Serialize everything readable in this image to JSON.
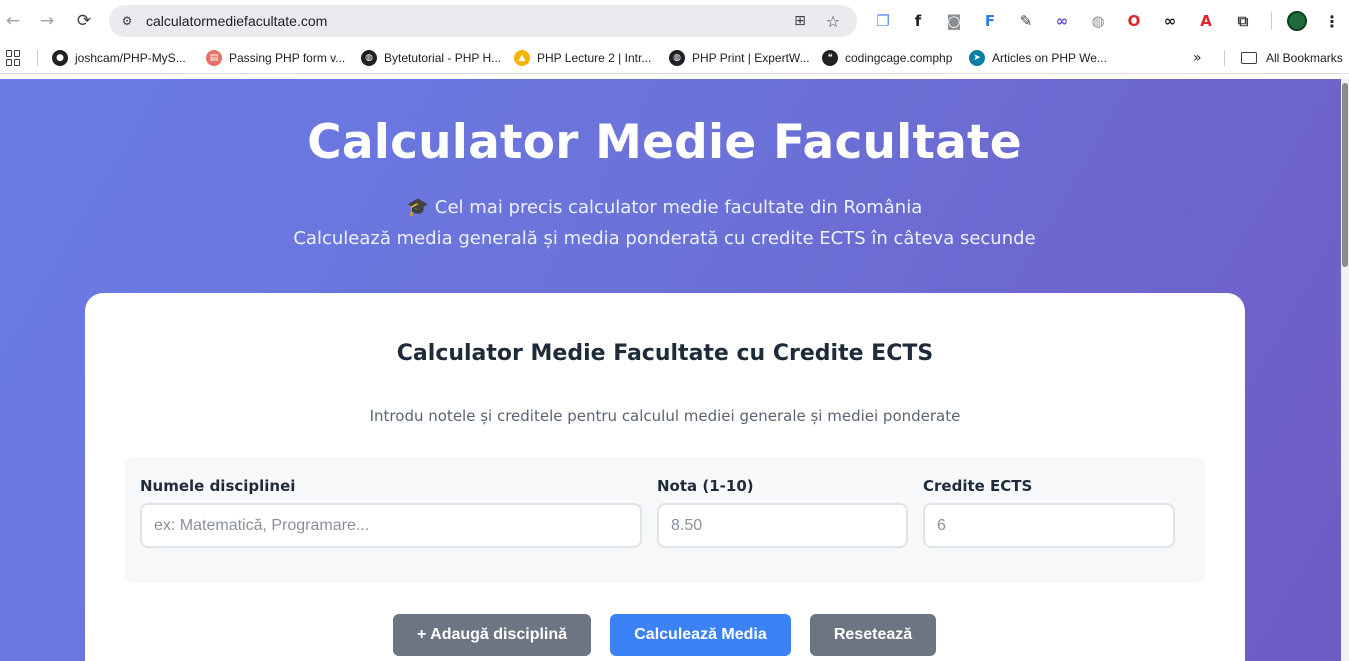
{
  "browser": {
    "url": "calculatormediefacultate.com",
    "extensions": [
      {
        "name": "layers-ext-icon",
        "glyph": "❐",
        "color": "#5b8def"
      },
      {
        "name": "formula-ext-icon",
        "glyph": "f",
        "color": "#202124"
      },
      {
        "name": "camera-ext-icon",
        "glyph": "◙",
        "color": "#8a8d91"
      },
      {
        "name": "ft-ext-icon",
        "glyph": "F",
        "color": "#2f7de1"
      },
      {
        "name": "feather-ext-icon",
        "glyph": "✎",
        "color": "#3c4043"
      },
      {
        "name": "link-ext-icon",
        "glyph": "∞",
        "color": "#5b4de0"
      },
      {
        "name": "globe-ext-icon",
        "glyph": "◍",
        "color": "#8a8d91"
      },
      {
        "name": "opera-ext-icon",
        "glyph": "O",
        "color": "#e0252b"
      },
      {
        "name": "infinity-ext-icon",
        "glyph": "∞",
        "color": "#202124"
      },
      {
        "name": "pdf-ext-icon",
        "glyph": "A",
        "color": "#e0252b"
      },
      {
        "name": "puzzle-ext-icon",
        "glyph": "⧉",
        "color": "#3c4043"
      }
    ]
  },
  "bookmarks": {
    "items": [
      {
        "label": "joshcam/PHP-MyS...",
        "icon": "github-icon",
        "color": "#202124",
        "glyph": "●"
      },
      {
        "label": "Passing PHP form v...",
        "icon": "page-icon",
        "color": "#e57368",
        "glyph": "▤"
      },
      {
        "label": "Bytetutorial - PHP H...",
        "icon": "globe-icon",
        "color": "#202124",
        "glyph": "◍"
      },
      {
        "label": "PHP Lecture 2 | Intr...",
        "icon": "drive-icon",
        "color": "#f4b400",
        "glyph": "▲"
      },
      {
        "label": "PHP Print | ExpertW...",
        "icon": "globe-icon",
        "color": "#202124",
        "glyph": "◍"
      },
      {
        "label": "codingcage.comphp",
        "icon": "quote-icon",
        "color": "#202124",
        "glyph": "❝"
      },
      {
        "label": "Articles on PHP We...",
        "icon": "arrow-icon",
        "color": "#0a7ea4",
        "glyph": "➤"
      }
    ],
    "all_label": "All Bookmarks"
  },
  "hero": {
    "title": "Calculator Medie Facultate",
    "subtitle_1": "🎓 Cel mai precis calculator medie facultate din România",
    "subtitle_2": "Calculează media generală și media ponderată cu credite ECTS în câteva secunde"
  },
  "card": {
    "title": "Calculator Medie Facultate cu Credite ECTS",
    "description": "Introdu notele și creditele pentru calculul mediei generale și mediei ponderate",
    "fields": {
      "subject_label": "Numele disciplinei",
      "subject_placeholder": "ex: Matematică, Programare...",
      "grade_label": "Nota (1-10)",
      "grade_placeholder": "8.50",
      "credits_label": "Credite ECTS",
      "credits_placeholder": "6"
    },
    "buttons": {
      "add": "+ Adaugă disciplină",
      "calculate": "Calculează Media",
      "reset": "Resetează"
    }
  },
  "colors": {
    "gradient_start": "#6a7de6",
    "gradient_end": "#6e5bc4",
    "primary_button": "#3b82f6",
    "secondary_button": "#6c7581"
  }
}
